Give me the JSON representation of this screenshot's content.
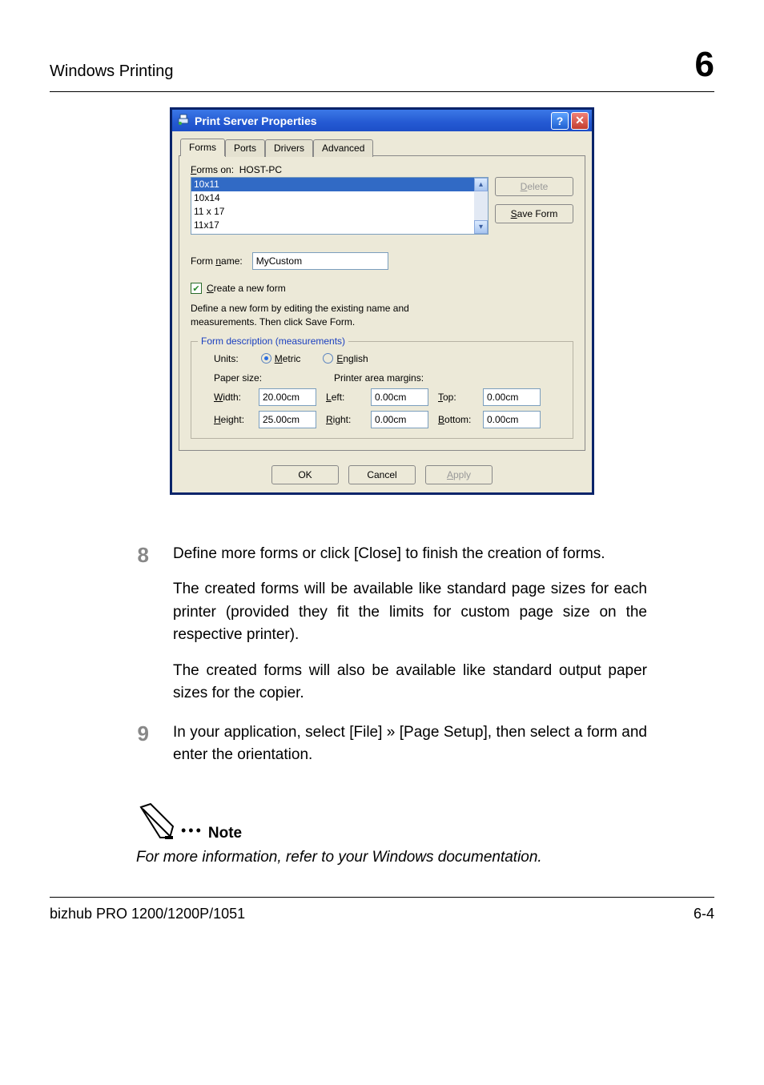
{
  "header": {
    "left": "Windows Printing",
    "right": "6"
  },
  "dialog": {
    "title": "Print Server Properties",
    "tabs": [
      "Forms",
      "Ports",
      "Drivers",
      "Advanced"
    ],
    "active_tab": 0,
    "forms_on_label": "Forms on:",
    "forms_on_value": "HOST-PC",
    "list_items": [
      "10x11",
      "10x14",
      "11 x 17",
      "11x17"
    ],
    "list_selected_index": 0,
    "btn_delete": "Delete",
    "btn_saveform": "Save Form",
    "form_name_label": "Form name:",
    "form_name_value": "MyCustom",
    "create_new_label": "Create a new form",
    "create_new_checked": true,
    "define_line1": "Define a new form by editing the existing name and",
    "define_line2": "measurements.  Then click Save Form.",
    "fieldset_legend": "Form description (measurements)",
    "units_label": "Units:",
    "units_metric": "Metric",
    "units_english": "English",
    "units_selected": "metric",
    "paper_size_label": "Paper size:",
    "margins_label": "Printer area margins:",
    "width_label": "Width:",
    "width_value": "20.00cm",
    "height_label": "Height:",
    "height_value": "25.00cm",
    "left_label": "Left:",
    "left_value": "0.00cm",
    "right_label": "Right:",
    "right_value": "0.00cm",
    "top_label": "Top:",
    "top_value": "0.00cm",
    "bottom_label": "Bottom:",
    "bottom_value": "0.00cm",
    "ok": "OK",
    "cancel": "Cancel",
    "apply": "Apply"
  },
  "steps": {
    "s8_num": "8",
    "s8_p1": "Define more forms or click [Close] to finish the creation of forms.",
    "s8_p2": "The created forms will be available like standard page sizes for each printer (provided they fit the limits for custom page size on the respective printer).",
    "s8_p3": "The created forms will also be available like standard output paper sizes for the copier.",
    "s9_num": "9",
    "s9_p1": "In your application, select [File] » [Page Setup], then select a form and enter the orientation."
  },
  "note": {
    "label": "Note",
    "text": "For more information, refer to your Windows documentation."
  },
  "footer": {
    "left": "bizhub PRO 1200/1200P/1051",
    "right": "6-4"
  }
}
